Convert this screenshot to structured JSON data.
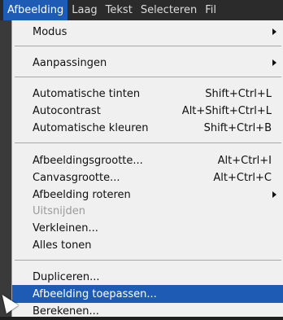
{
  "menubar": {
    "items": [
      "Afbeelding",
      "Laag",
      "Tekst",
      "Selecteren",
      "Fil"
    ]
  },
  "menu": {
    "modus": {
      "label": "Modus"
    },
    "aanpassingen": {
      "label": "Aanpassingen"
    },
    "auto_tinten": {
      "label": "Automatische tinten",
      "shortcut": "Shift+Ctrl+L"
    },
    "autocontrast": {
      "label": "Autocontrast",
      "shortcut": "Alt+Shift+Ctrl+L"
    },
    "auto_kleuren": {
      "label": "Automatische kleuren",
      "shortcut": "Shift+Ctrl+B"
    },
    "afbeeldingsgrootte": {
      "label": "Afbeeldingsgrootte...",
      "shortcut": "Alt+Ctrl+I"
    },
    "canvasgrootte": {
      "label": "Canvasgrootte...",
      "shortcut": "Alt+Ctrl+C"
    },
    "roteren": {
      "label": "Afbeelding roteren"
    },
    "uitsnijden": {
      "label": "Uitsnijden"
    },
    "verkleinen": {
      "label": "Verkleinen..."
    },
    "alles_tonen": {
      "label": "Alles tonen"
    },
    "dupliceren": {
      "label": "Dupliceren..."
    },
    "toepassen": {
      "label": "Afbeelding toepassen..."
    },
    "berekenen": {
      "label": "Berekenen..."
    }
  },
  "colors": {
    "highlight": "#1e5bb5",
    "menu_bg": "#f0f0f0",
    "disabled_text": "#9a9a9a"
  }
}
